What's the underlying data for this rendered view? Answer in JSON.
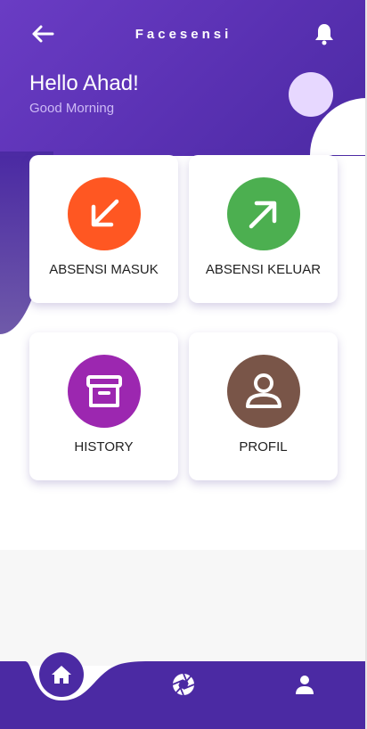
{
  "header": {
    "title": "Facesensi",
    "back_icon": "arrow-left-icon",
    "notification_icon": "bell-icon",
    "greeting": "Hello Ahad!",
    "subgreeting": "Good Morning"
  },
  "menu": {
    "items": [
      {
        "label": "ABSENSI MASUK",
        "icon": "arrow-down-left-icon",
        "color": "#ff5722"
      },
      {
        "label": "ABSENSI KELUAR",
        "icon": "arrow-up-right-icon",
        "color": "#4caf50"
      },
      {
        "label": "HISTORY",
        "icon": "archive-box-icon",
        "color": "#9c27b0"
      },
      {
        "label": "PROFIL",
        "icon": "user-icon",
        "color": "#795548"
      }
    ]
  },
  "bottom_nav": {
    "items": [
      {
        "icon": "home-icon",
        "active": true
      },
      {
        "icon": "camera-aperture-icon",
        "active": false
      },
      {
        "icon": "person-icon",
        "active": false
      }
    ]
  },
  "colors": {
    "primary": "#5a31b3",
    "primary_dark": "#4b2aa3",
    "avatar_bg": "#e7d8ff"
  }
}
